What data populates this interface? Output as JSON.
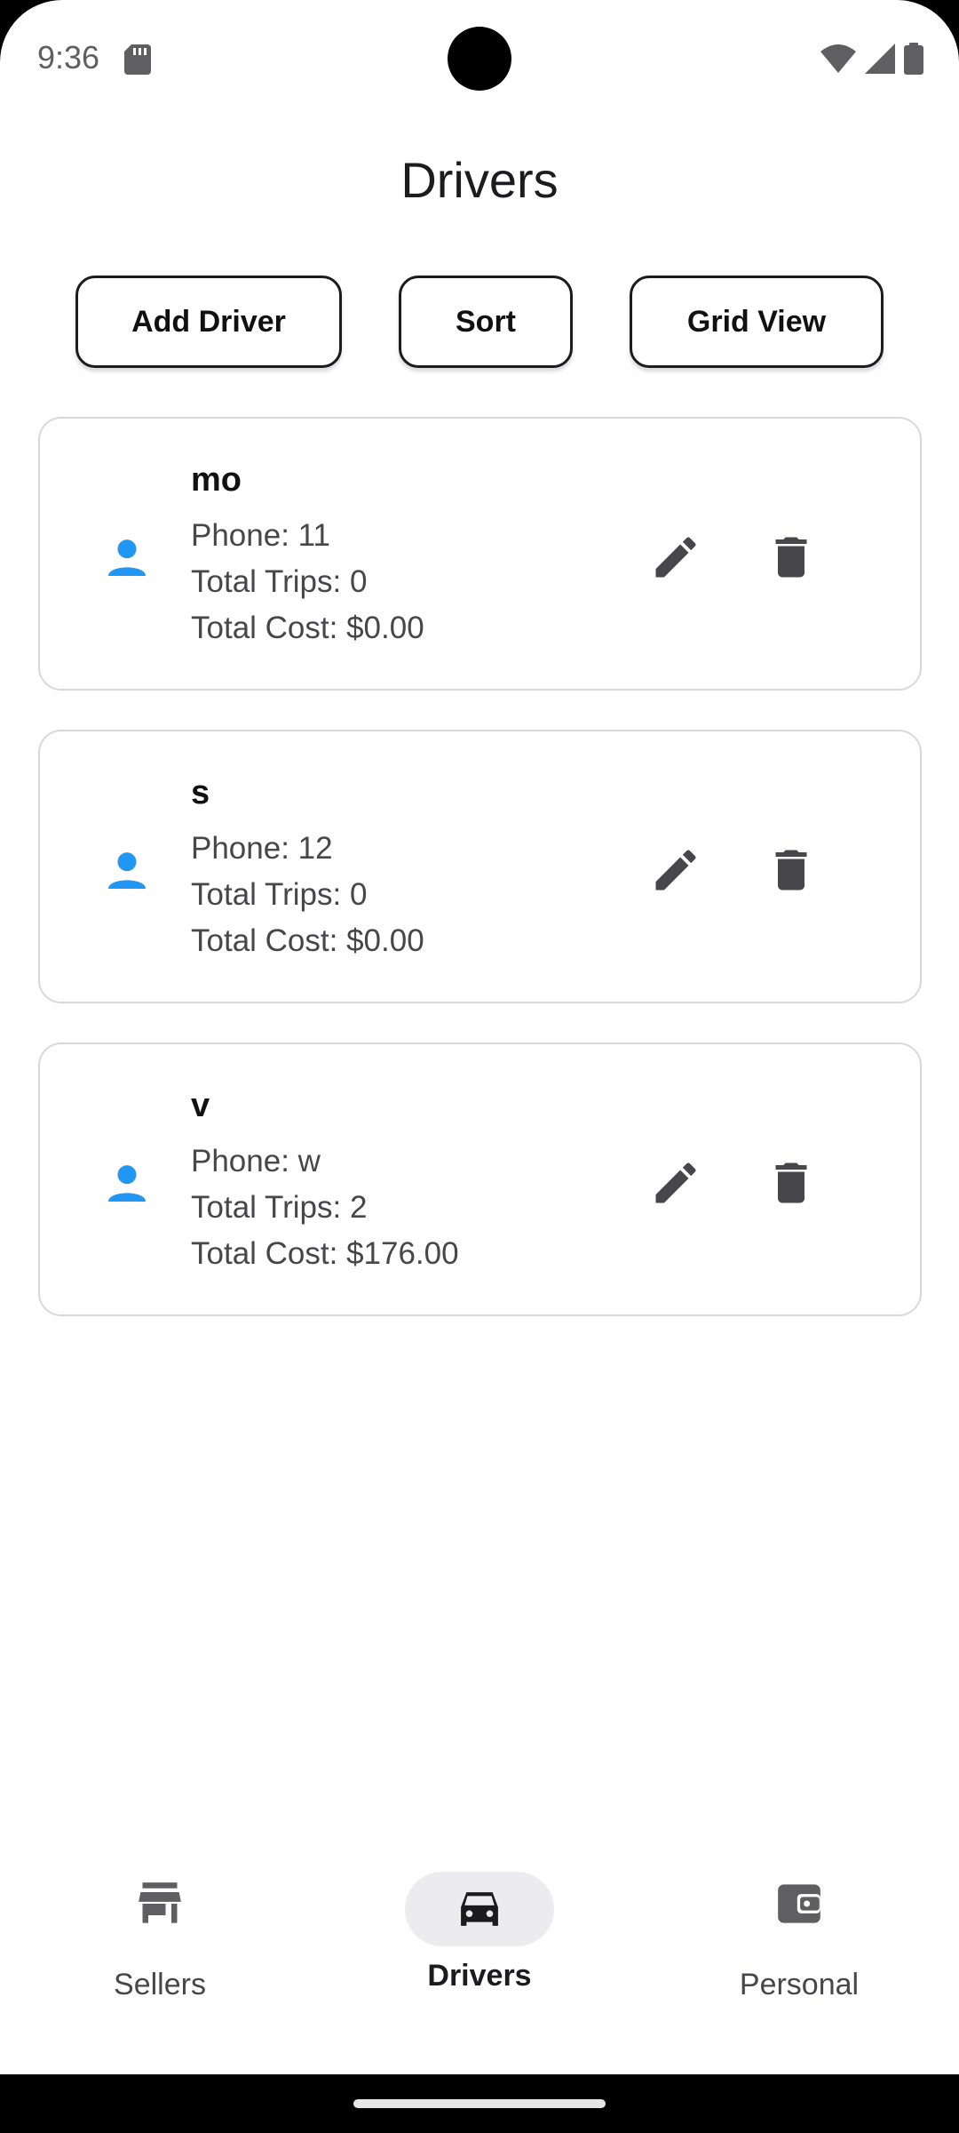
{
  "status_bar": {
    "time": "9:36"
  },
  "header": {
    "title": "Drivers"
  },
  "actions": {
    "add_label": "Add Driver",
    "sort_label": "Sort",
    "grid_label": "Grid View"
  },
  "drivers": [
    {
      "name": "mo",
      "phone": "Phone: 11",
      "trips": "Total Trips: 0",
      "cost": "Total Cost: $0.00"
    },
    {
      "name": "s",
      "phone": "Phone: 12",
      "trips": "Total Trips: 0",
      "cost": "Total Cost: $0.00"
    },
    {
      "name": "v",
      "phone": "Phone: w",
      "trips": "Total Trips: 2",
      "cost": "Total Cost: $176.00"
    }
  ],
  "bottom_nav": {
    "items": [
      {
        "label": "Sellers",
        "icon": "store-icon",
        "active": false
      },
      {
        "label": "Drivers",
        "icon": "car-icon",
        "active": true
      },
      {
        "label": "Personal",
        "icon": "wallet-icon",
        "active": false
      }
    ]
  },
  "colors": {
    "accent_person": "#2196f3",
    "icon_dark": "#46464b",
    "nav_active_bg": "#ececee"
  }
}
